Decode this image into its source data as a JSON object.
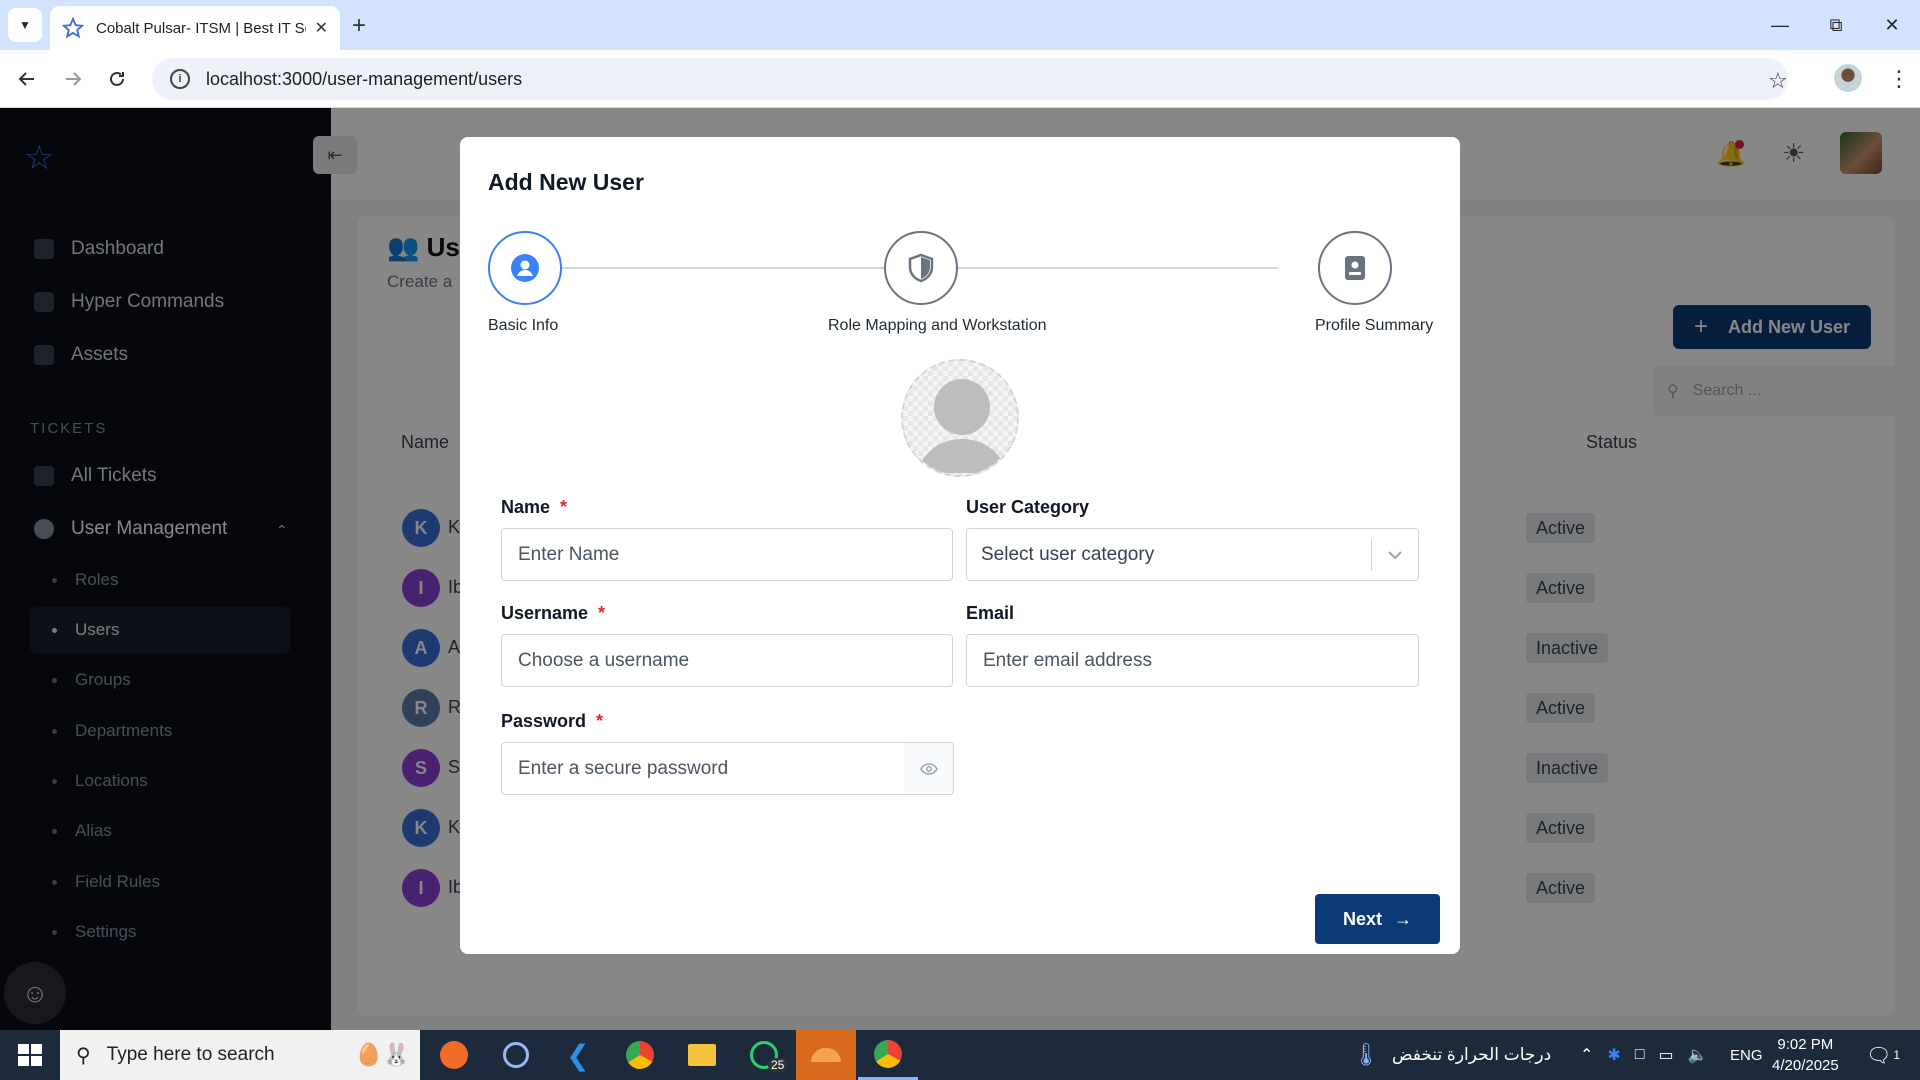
{
  "browser": {
    "tab_title": "Cobalt Pulsar- ITSM | Best IT Se",
    "url": "localhost:3000/user-management/users"
  },
  "sidebar": {
    "items_top": [
      {
        "label": "Dashboard"
      },
      {
        "label": "Hyper Commands"
      },
      {
        "label": "Assets"
      }
    ],
    "section_label": "TICKETS",
    "items_tickets": [
      {
        "label": "All Tickets"
      },
      {
        "label": "User Management"
      }
    ],
    "sub_items": [
      {
        "label": "Roles"
      },
      {
        "label": "Users"
      },
      {
        "label": "Groups"
      },
      {
        "label": "Departments"
      },
      {
        "label": "Locations"
      },
      {
        "label": "Alias"
      },
      {
        "label": "Field Rules"
      },
      {
        "label": "Settings"
      }
    ]
  },
  "page": {
    "title": "Us",
    "subtitle": "Create a",
    "add_button": "Add New User",
    "search_placeholder": "Search ...",
    "col_name": "Name",
    "col_status": "Status",
    "rows": [
      {
        "initial": "K",
        "name": "K",
        "status": "Active",
        "color": "#3b6fd6"
      },
      {
        "initial": "I",
        "name": "Ib",
        "status": "Active",
        "color": "#8b3fd6"
      },
      {
        "initial": "A",
        "name": "A",
        "status": "Inactive",
        "color": "#3b6fd6"
      },
      {
        "initial": "R",
        "name": "R",
        "status": "Active",
        "color": "#5c7ca8"
      },
      {
        "initial": "S",
        "name": "S",
        "status": "Inactive",
        "color": "#8b3fd6"
      },
      {
        "initial": "K",
        "name": "K",
        "status": "Active",
        "color": "#3b6fd6"
      },
      {
        "initial": "I",
        "name": "Ib",
        "status": "Active",
        "color": "#8b3fd6"
      }
    ]
  },
  "modal": {
    "title": "Add New User",
    "steps": [
      {
        "label": "Basic Info",
        "icon": "user-circle-icon"
      },
      {
        "label": "Role Mapping and Workstation",
        "icon": "shield-icon"
      },
      {
        "label": "Profile Summary",
        "icon": "id-card-icon"
      }
    ],
    "name_label": "Name",
    "name_placeholder": "Enter Name",
    "category_label": "User Category",
    "category_placeholder": "Select user category",
    "username_label": "Username",
    "username_placeholder": "Choose a username",
    "email_label": "Email",
    "email_placeholder": "Enter email address",
    "password_label": "Password",
    "password_placeholder": "Enter a secure password",
    "required_mark": "*",
    "next_label": "Next"
  },
  "taskbar": {
    "search_placeholder": "Type here to search",
    "weather_text": "درجات الحرارة تنخفض",
    "lang": "ENG",
    "time": "9:02 PM",
    "date": "4/20/2025",
    "whatsapp_badge": "25",
    "notif_count": "1"
  },
  "colors": {
    "accent": "#0b3a75",
    "step_active": "#3b82f6",
    "sidebar_bg": "#0a0e18",
    "required": "#dc2626"
  }
}
